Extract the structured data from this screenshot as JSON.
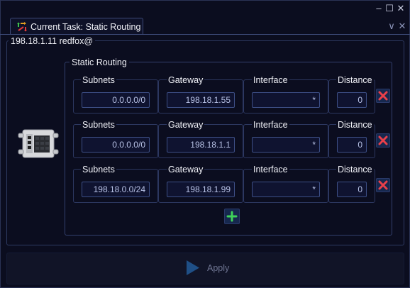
{
  "window": {
    "controls": {
      "minimize": "–",
      "maximize": "☐",
      "close": "✕"
    }
  },
  "tab": {
    "title": "Current Task: Static Routing",
    "icon": "routing-arrows-icon",
    "controls": {
      "dropdown": "∨",
      "close": "✕"
    }
  },
  "device": {
    "label": "198.18.1.11 redfox@",
    "icon": "network-switch-icon"
  },
  "static_routing": {
    "title": "Static Routing",
    "columns": {
      "subnets": "Subnets",
      "gateway": "Gateway",
      "interface": "Interface",
      "distance": "Distance"
    },
    "routes": [
      {
        "subnet": "0.0.0.0/0",
        "gateway": "198.18.1.55",
        "interface": "*",
        "distance": "0"
      },
      {
        "subnet": "0.0.0.0/0",
        "gateway": "198.18.1.1",
        "interface": "*",
        "distance": "0"
      },
      {
        "subnet": "198.18.0.0/24",
        "gateway": "198.18.1.99",
        "interface": "*",
        "distance": "0"
      }
    ],
    "delete_icon": "delete-x-icon",
    "add_icon": "plus-icon"
  },
  "apply": {
    "label": "Apply",
    "icon": "play-icon"
  },
  "colors": {
    "background": "#0b0d1f",
    "border": "#2e3a62",
    "input_text": "#b8c2e6",
    "delete_red": "#e8404a",
    "add_green": "#3fd35a",
    "apply_icon": "#1f4f86"
  }
}
